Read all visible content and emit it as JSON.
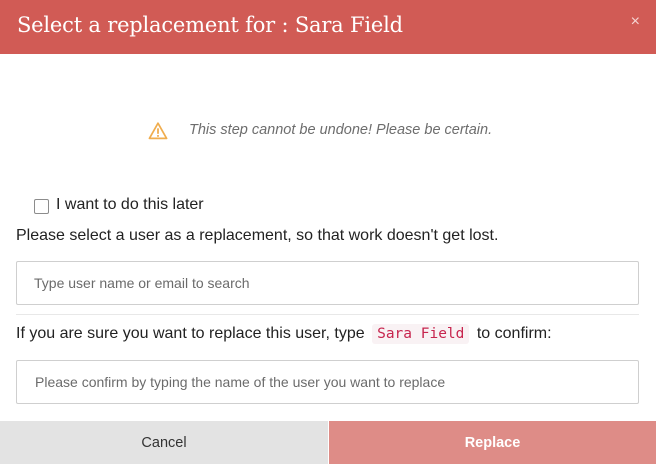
{
  "dialog": {
    "title": "Select a replacement for : Sara Field",
    "close_symbol": "×",
    "warning_icon": "warning-triangle-icon",
    "warning_color": "#f0ad4e",
    "warning_text": "This step cannot be undone! Please be certain.",
    "later_checkbox": {
      "label": "I want to do this later",
      "checked": false
    },
    "instruction": "Please select a user as a replacement, so that work doesn't get lost.",
    "search": {
      "placeholder": "Type user name or email to search",
      "value": ""
    },
    "confirm": {
      "prefix": "If you are sure you want to replace this user, type",
      "user_name": "Sara Field",
      "suffix": "to confirm:",
      "placeholder": "Please confirm by typing the name of the user you want to replace",
      "value": ""
    },
    "buttons": {
      "cancel": "Cancel",
      "replace": "Replace"
    },
    "colors": {
      "header": "#d15b55",
      "replace_button": "#de8c87",
      "cancel_button": "#e3e3e3",
      "code_text": "#c7254e"
    }
  }
}
